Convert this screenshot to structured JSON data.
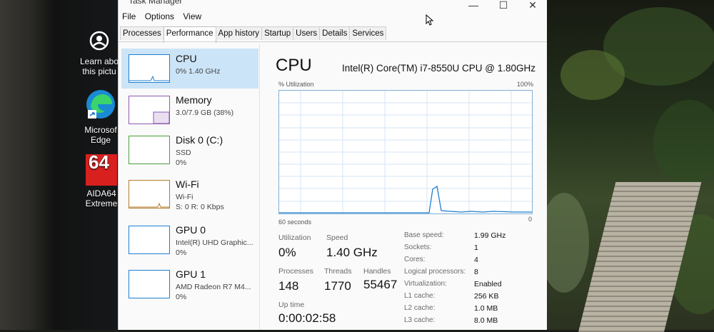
{
  "window": {
    "title": "Task Manager",
    "controls": {
      "minimize": "—",
      "maximize": "☐",
      "close": "✕"
    }
  },
  "menu": [
    "File",
    "Options",
    "View"
  ],
  "tabs": [
    "Processes",
    "Performance",
    "App history",
    "Startup",
    "Users",
    "Details",
    "Services"
  ],
  "active_tab": "Performance",
  "resources": [
    {
      "name": "CPU",
      "sub": "0% 1.40 GHz",
      "sub2": ""
    },
    {
      "name": "Memory",
      "sub": "3.0/7.9 GB (38%)",
      "sub2": ""
    },
    {
      "name": "Disk 0 (C:)",
      "sub": "SSD",
      "sub2": "0%"
    },
    {
      "name": "Wi-Fi",
      "sub": "Wi-Fi",
      "sub2": "S: 0 R: 0 Kbps"
    },
    {
      "name": "GPU 0",
      "sub": "Intel(R) UHD Graphic...",
      "sub2": "0%"
    },
    {
      "name": "GPU 1",
      "sub": "AMD Radeon R7 M4...",
      "sub2": "0%"
    }
  ],
  "cpu_panel": {
    "title": "CPU",
    "model": "Intel(R) Core(TM) i7-8550U CPU @ 1.80GHz",
    "graph": {
      "y_label": "% Utilization",
      "y_max_label": "100%",
      "x_label": "60 seconds",
      "x_min_label": "0"
    },
    "stats": {
      "utilization_label": "Utilization",
      "utilization": "0%",
      "speed_label": "Speed",
      "speed": "1.40 GHz",
      "processes_label": "Processes",
      "processes": "148",
      "threads_label": "Threads",
      "threads": "1770",
      "handles_label": "Handles",
      "handles": "55467",
      "uptime_label": "Up time",
      "uptime": "0:00:02:58"
    },
    "details": [
      {
        "label": "Base speed:",
        "value": "1.99 GHz"
      },
      {
        "label": "Sockets:",
        "value": "1"
      },
      {
        "label": "Cores:",
        "value": "4"
      },
      {
        "label": "Logical processors:",
        "value": "8"
      },
      {
        "label": "Virtualization:",
        "value": "Enabled"
      },
      {
        "label": "L1 cache:",
        "value": "256 KB"
      },
      {
        "label": "L2 cache:",
        "value": "1.0 MB"
      },
      {
        "label": "L3 cache:",
        "value": "8.0 MB"
      }
    ]
  },
  "desktop_icons": [
    {
      "label1": "Learn abo",
      "label2": "this pictu",
      "icon": "camera-icon"
    },
    {
      "label1": "Microsof",
      "label2": "Edge",
      "icon": "edge-icon"
    },
    {
      "label1": "AIDA64",
      "label2": "Extreme",
      "icon": "aida64-icon"
    }
  ],
  "aida_badge": "64",
  "colors": {
    "selection": "#cce4f7",
    "graph_line": "#1f7fd0",
    "grid": "#d6e6f4"
  }
}
